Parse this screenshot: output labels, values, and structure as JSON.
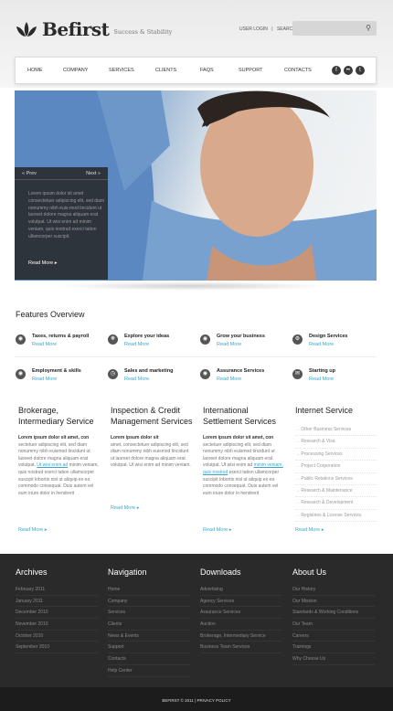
{
  "brand": {
    "name": "Befirst",
    "tagline": "Success & Stability"
  },
  "toplinks": {
    "login": "USER LOGIN",
    "divider": "|",
    "search": "SEARCH"
  },
  "nav": {
    "items": [
      "HOME",
      "COMPANY",
      "SERVICES",
      "CLIENTS",
      "FAQS",
      "SUPPORT",
      "CONTACTS"
    ],
    "social": [
      "f-icon",
      "flickr-icon",
      "twitter-icon"
    ]
  },
  "hero": {
    "prev": "« Prev",
    "next": "Next »",
    "text": "Lorem ipsum dolor sit amet consectetuer adipiscing elit, sed diam nonummy nibh euis-mod tincidunt ut laoreet dolore magna aliquam erat volutpat. Ut wisi enim ad minim veniam, quis nostrud exerci tation ullamcorper suscipit.",
    "more": "Read More"
  },
  "features": {
    "title": "Features Overview",
    "items": [
      {
        "title": "Taxes, returns & payroll",
        "more": "Read More",
        "icon": "globe-icon"
      },
      {
        "title": "Explore your ideas",
        "more": "Read More",
        "icon": "lifebuoy-icon"
      },
      {
        "title": "Grow your business",
        "more": "Read More",
        "icon": "globe-icon"
      },
      {
        "title": "Design Services",
        "more": "Read More",
        "icon": "gear-icon"
      },
      {
        "title": "Employment & skills",
        "more": "Read More",
        "icon": "globe-icon"
      },
      {
        "title": "Sales and marketing",
        "more": "Read More",
        "icon": "clock-icon"
      },
      {
        "title": "Assurance Services",
        "more": "Read More",
        "icon": "globe-icon"
      },
      {
        "title": "Starting up",
        "more": "Read More",
        "icon": "chat-icon"
      }
    ]
  },
  "columns": [
    {
      "title": "Brokerage, Intermediary Service",
      "lead": "Lorem ipsum dolor sit amet, con",
      "body_before": "sectetuer adipiscing elit, sed diam nonummy nibh euismod tincidunt ut laoreet dolore magna aliquam erat volutpat.",
      "link": "Ut wisi enim ad",
      "body_after": "minim veniam, quis nostrud exerci tation ullamcorper suscipit lobortis nisl ut aliquip ex ea commodo consequat. Duis autem vel eum iriure dolor in hendrerit",
      "more": "Read More"
    },
    {
      "title": "Inspection & Credit Management Services",
      "lead": "Lorem ipsum dolor sit",
      "body_before": "amet, consectetuer adipiscing elit, sed diam nonummy nibh euismod tincidunt ut laoreet dolore magna aliquam erat volutpat. Ut wisi enim ad minim veniam.",
      "link": "",
      "body_after": "",
      "more": "Read More"
    },
    {
      "title": "International Settlement Services",
      "lead": "Lorem ipsum dolor sit amet, con",
      "body_before": "sectetuer adipiscing elit, sed diam nonummy nibh euismod tincidunt ut laoreet dolore magna aliquam erat volutpat. Ut wisi enim ad",
      "link": "minim veniam, quis nostrud",
      "body_after": "exerci tation ullamcorper suscipit lobortis nisl ut aliquip ex ea commodo consequat. Duis autem vel eum iriure dolor in hendrerit",
      "more": "Read More"
    },
    {
      "title": "Internet Service",
      "list": [
        "Other Business Services",
        "Research & Visa",
        "Processing Services",
        "Project Corporation",
        "Public Relations Services",
        "Research & Maintenance",
        "Research & Development",
        "Registries & License Services"
      ],
      "more": "Read More"
    }
  ],
  "footer": {
    "columns": [
      {
        "title": "Archives",
        "items": [
          "February 2011",
          "January 2011",
          "December 2010",
          "November 2010",
          "October 2010",
          "September 2010"
        ]
      },
      {
        "title": "Navigation",
        "items": [
          "Home",
          "Company",
          "Services",
          "Clients",
          "News & Events",
          "Support",
          "Contacts",
          "Help Center"
        ]
      },
      {
        "title": "Downloads",
        "items": [
          "Advertising",
          "Agency Services",
          "Assurance Services",
          "Auction",
          "Brokerage, Intermediary Service",
          "Business Team Services"
        ]
      },
      {
        "title": "About Us",
        "items": [
          "Our History",
          "Our Mission",
          "Standards & Working Conditions",
          "Our Team",
          "Careers",
          "Trainings",
          "Why Choose Us"
        ]
      }
    ],
    "copyright": "BEFIRST © 2011 | PRIVACY POLICY"
  }
}
